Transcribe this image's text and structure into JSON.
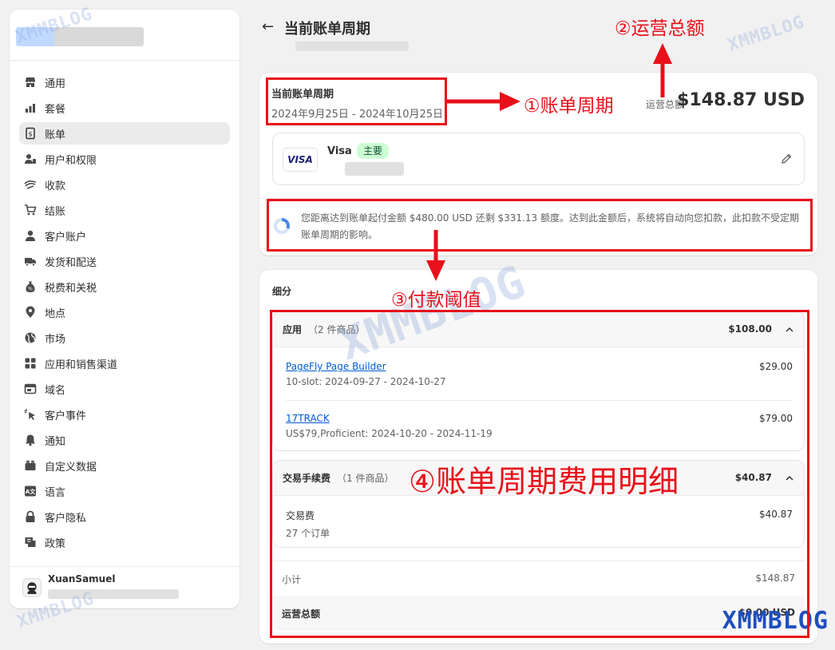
{
  "sidebar": {
    "items": [
      {
        "label": "通用",
        "icon": "store-icon",
        "active": false
      },
      {
        "label": "套餐",
        "icon": "plan-chart-icon",
        "active": false
      },
      {
        "label": "账单",
        "icon": "billing-icon",
        "active": true
      },
      {
        "label": "用户和权限",
        "icon": "users-icon",
        "active": false
      },
      {
        "label": "收款",
        "icon": "payments-icon",
        "active": false
      },
      {
        "label": "结账",
        "icon": "cart-icon",
        "active": false
      },
      {
        "label": "客户账户",
        "icon": "person-icon",
        "active": false
      },
      {
        "label": "发货和配送",
        "icon": "truck-icon",
        "active": false
      },
      {
        "label": "税费和关税",
        "icon": "tax-bag-icon",
        "active": false
      },
      {
        "label": "地点",
        "icon": "location-pin-icon",
        "active": false
      },
      {
        "label": "市场",
        "icon": "globe-icon",
        "active": false
      },
      {
        "label": "应用和销售渠道",
        "icon": "apps-grid-icon",
        "active": false
      },
      {
        "label": "域名",
        "icon": "domain-icon",
        "active": false
      },
      {
        "label": "客户事件",
        "icon": "cursor-click-icon",
        "active": false
      },
      {
        "label": "通知",
        "icon": "bell-icon",
        "active": false
      },
      {
        "label": "自定义数据",
        "icon": "custom-data-icon",
        "active": false
      },
      {
        "label": "语言",
        "icon": "language-icon",
        "active": false
      },
      {
        "label": "客户隐私",
        "icon": "lock-icon",
        "active": false
      },
      {
        "label": "政策",
        "icon": "policy-icon",
        "active": false
      }
    ],
    "user_name": "XuanSamuel"
  },
  "header": {
    "back_label": "←",
    "title": "当前账单周期"
  },
  "cycle_card": {
    "title": "当前账单周期",
    "dates": "2024年9月25日 - 2024年10月25日",
    "total_label": "运营总额",
    "total_amount": "$148.87 USD",
    "payment": {
      "brand_logo": "VISA",
      "brand_name": "Visa",
      "badge": "主要"
    },
    "threshold_text": "您距离达到账单起付金额 $480.00 USD 还剩 $331.13 额度。达到此金额后，系统将自动向您扣款，此扣款不受定期账单周期的影响。",
    "threshold_progress": 0.31
  },
  "breakdown": {
    "title": "细分",
    "sections": [
      {
        "name": "应用",
        "count": "（2 件商品）",
        "amount": "$108.00",
        "items": [
          {
            "name": "PageFly Page Builder",
            "desc": "10-slot: 2024-09-27 - 2024-10-27",
            "amount": "$29.00"
          },
          {
            "name": "17TRACK",
            "desc": "US$79,Proficient: 2024-10-20 - 2024-11-19",
            "amount": "$79.00"
          }
        ]
      },
      {
        "name": "交易手续费",
        "count": "（1 件商品）",
        "amount": "$40.87",
        "items": [
          {
            "name": "交易费",
            "desc": "27 个订单",
            "amount": "$40.87"
          }
        ]
      }
    ],
    "subtotal_label": "小计",
    "subtotal_amount": "$148.87",
    "grand_label": "运营总额",
    "grand_amount": "$0.00 USD"
  },
  "annotations": {
    "a1": "①账单周期",
    "a2": "②运营总额",
    "a3": "③付款阈值",
    "a4": "④账单周期费用明细",
    "color": "#e8101a"
  },
  "watermark": "XMMBLOG"
}
